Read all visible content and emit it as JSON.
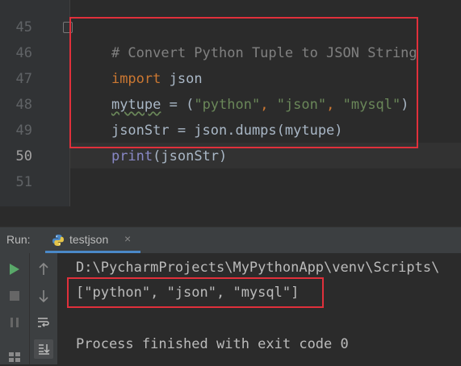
{
  "editor": {
    "line_numbers": [
      "45",
      "46",
      "47",
      "48",
      "49",
      "50",
      "51"
    ],
    "lines": {
      "l45_comment": "# Convert Python Tuple to JSON String",
      "l46_kw": "import",
      "l46_rest": " json",
      "l47_var": "mytupe",
      "l47_eq": " = (",
      "l47_s1": "\"python\"",
      "l47_sep1": ", ",
      "l47_s2": "\"json\"",
      "l47_sep2": ", ",
      "l47_s3": "\"mysql\"",
      "l47_close": ")",
      "l48": "jsonStr = json.dumps(mytupe)",
      "l49_builtin": "print",
      "l49_rest": "(jsonStr)"
    }
  },
  "run_panel": {
    "label": "Run:",
    "tab_label": "testjson",
    "tab_close": "×",
    "console_lines": {
      "path": "D:\\PycharmProjects\\MyPythonApp\\venv\\Scripts\\",
      "output": "[\"python\", \"json\", \"mysql\"]",
      "blank": "",
      "finished": "Process finished with exit code 0"
    }
  },
  "colors": {
    "highlight_box": "#e0303b",
    "run_green": "#59a869"
  }
}
